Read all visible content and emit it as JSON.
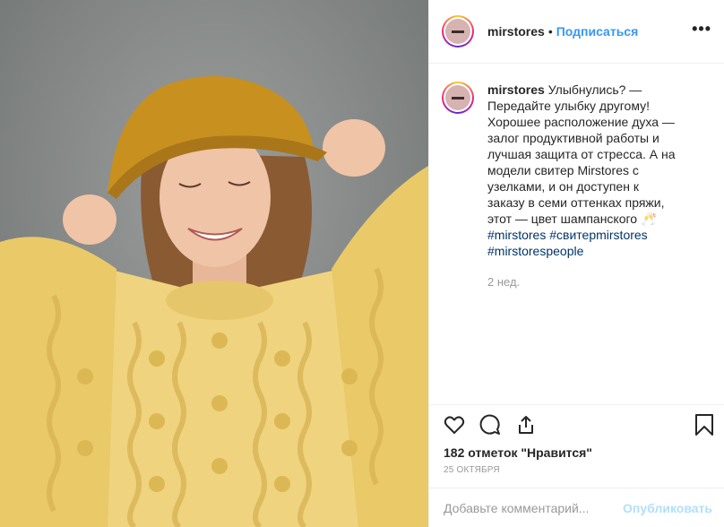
{
  "post": {
    "username": "mirstores",
    "follow_label": "Подписаться",
    "dot": "•",
    "more": "•••"
  },
  "caption": {
    "username": "mirstores",
    "text": "Улыбнулись? — Передайте улыбку другому! Хорошее расположение духа — залог продуктивной работы и лучшая защита от стресса. А на модели свитер Mirstores с узелками, и он доступен к заказу в семи оттенках пряжи, этот — цвет шампанского 🥂",
    "hashtags": [
      "#mirstores",
      "#свитерmirstores",
      "#mirstorespeople"
    ],
    "time": "2 нед."
  },
  "likes": "182 отметок \"Нравится\"",
  "date": "25 ОКТЯБРЯ",
  "comment": {
    "placeholder": "Добавьте комментарий...",
    "post_label": "Опубликовать"
  },
  "colors": {
    "accent": "#3897f0",
    "hashtag": "#003569",
    "sweater": "#efd37e",
    "hat": "#c8901f"
  }
}
